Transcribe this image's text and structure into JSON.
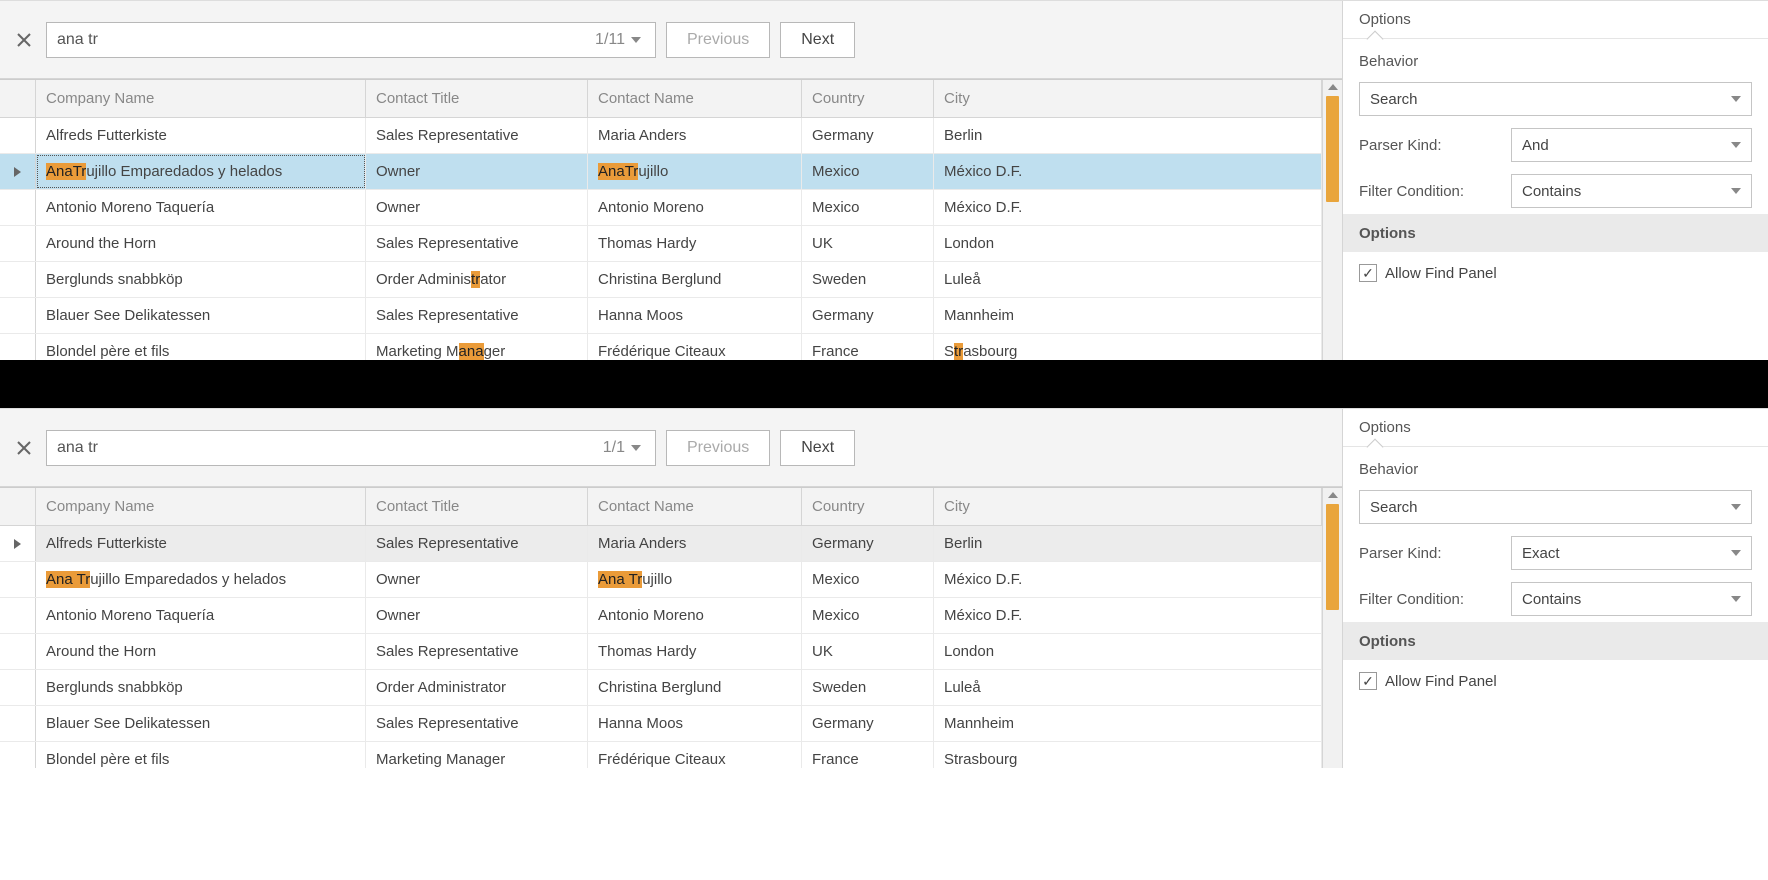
{
  "columns": [
    "Company Name",
    "Contact Title",
    "Contact Name",
    "Country",
    "City"
  ],
  "rows": [
    {
      "company": "Alfreds Futterkiste",
      "title": "Sales Representative",
      "name": "Maria Anders",
      "country": "Germany",
      "city": "Berlin"
    },
    {
      "company": "Ana Trujillo Emparedados y helados",
      "title": "Owner",
      "name": "Ana Trujillo",
      "country": "Mexico",
      "city": "México D.F."
    },
    {
      "company": "Antonio Moreno Taquería",
      "title": "Owner",
      "name": "Antonio Moreno",
      "country": "Mexico",
      "city": "México D.F."
    },
    {
      "company": "Around the Horn",
      "title": "Sales Representative",
      "name": "Thomas Hardy",
      "country": "UK",
      "city": "London"
    },
    {
      "company": "Berglunds snabbköp",
      "title": "Order Administrator",
      "name": "Christina Berglund",
      "country": "Sweden",
      "city": "Luleå"
    },
    {
      "company": "Blauer See Delikatessen",
      "title": "Sales Representative",
      "name": "Hanna Moos",
      "country": "Germany",
      "city": "Mannheim"
    },
    {
      "company": "Blondel père et fils",
      "title": "Marketing Manager",
      "name": "Frédérique Citeaux",
      "country": "France",
      "city": "Strasbourg"
    }
  ],
  "panel1": {
    "search_text": "ana tr",
    "counter": "1/11",
    "prev": "Previous",
    "next": "Next",
    "highlight_mode": "tokens",
    "selected_row": 1,
    "focused_row": 1,
    "options": {
      "title": "Options",
      "behavior_label": "Behavior",
      "behavior_value": "Search",
      "parser_label": "Parser Kind:",
      "parser_value": "And",
      "filter_label": "Filter Condition:",
      "filter_value": "Contains",
      "section": "Options",
      "allow_find": "Allow Find Panel",
      "allow_find_checked": true
    }
  },
  "panel2": {
    "search_text": "ana tr",
    "counter": "1/1",
    "prev": "Previous",
    "next": "Next",
    "highlight_mode": "phrase_start",
    "selected_row": 0,
    "focused_row": 0,
    "options": {
      "title": "Options",
      "behavior_label": "Behavior",
      "behavior_value": "Search",
      "parser_label": "Parser Kind:",
      "parser_value": "Exact",
      "filter_label": "Filter Condition:",
      "filter_value": "Contains",
      "section": "Options",
      "allow_find": "Allow Find Panel",
      "allow_find_checked": true
    }
  }
}
